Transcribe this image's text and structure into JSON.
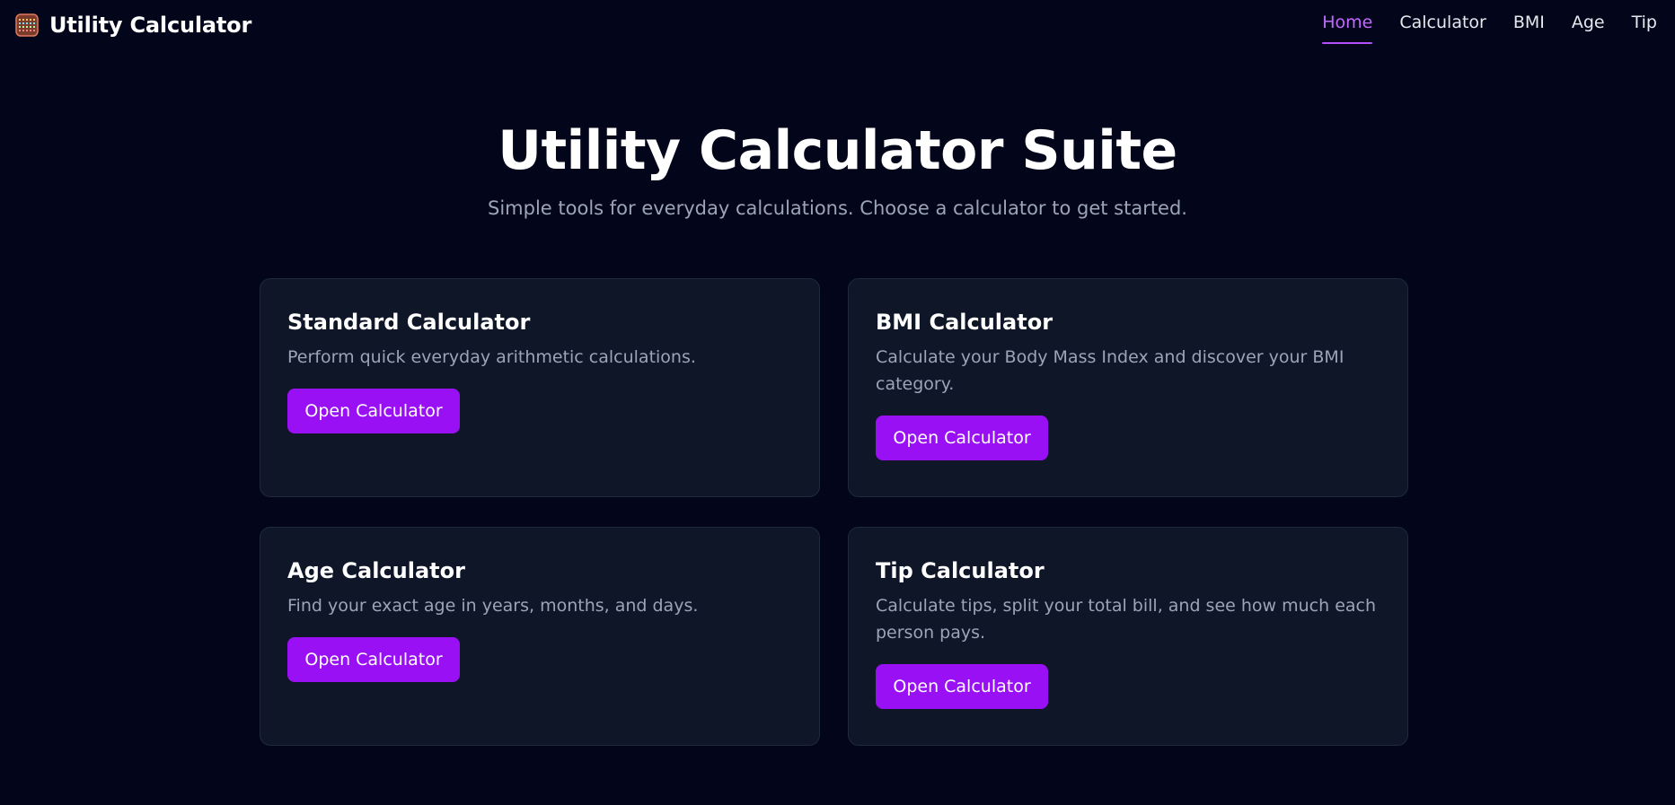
{
  "header": {
    "brand_title": "Utility Calculator",
    "brand_icon": "abacus-icon",
    "nav": [
      {
        "label": "Home",
        "active": true
      },
      {
        "label": "Calculator",
        "active": false
      },
      {
        "label": "BMI",
        "active": false
      },
      {
        "label": "Age",
        "active": false
      },
      {
        "label": "Tip",
        "active": false
      }
    ]
  },
  "hero": {
    "title": "Utility Calculator Suite",
    "subtitle": "Simple tools for everyday calculations. Choose a calculator to get started."
  },
  "cards": [
    {
      "title": "Standard Calculator",
      "description": "Perform quick everyday arithmetic calculations.",
      "button_label": "Open Calculator"
    },
    {
      "title": "BMI Calculator",
      "description": "Calculate your Body Mass Index and discover your BMI category.",
      "button_label": "Open Calculator"
    },
    {
      "title": "Age Calculator",
      "description": "Find your exact age in years, months, and days.",
      "button_label": "Open Calculator"
    },
    {
      "title": "Tip Calculator",
      "description": "Calculate tips, split your total bill, and see how much each person pays.",
      "button_label": "Open Calculator"
    }
  ],
  "colors": {
    "background": "#03061a",
    "card_background": "#0e1628",
    "accent": "#9a10f5",
    "nav_active": "#c268ff",
    "muted_text": "#9ba4b8"
  }
}
